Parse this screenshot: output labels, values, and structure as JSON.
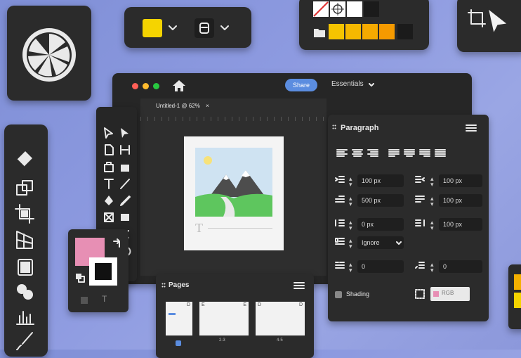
{
  "colors": {
    "bg": "#8c98db",
    "panel": "#2b2b2b",
    "accent_blue": "#5b8de0",
    "pink": "#e78fb4",
    "yellow": "#f5d400"
  },
  "app": {
    "share_label": "Share",
    "workspace_label": "Essentials",
    "doc_tab": "Untitled-1 @ 62%",
    "doc_tab_close": "×"
  },
  "paragraph": {
    "title": "Paragraph",
    "fields": {
      "indent_left": "100 px",
      "indent_right": "100 px",
      "first_line": "500 px",
      "space_after_list": "100 px",
      "space_before": "0 px",
      "space_after": "100 px",
      "hyphenation": "Ignore",
      "baseline_left": "0",
      "baseline_right": "0"
    },
    "shading_label": "Shading",
    "shading_color_label": "RGB"
  },
  "pages": {
    "title": "Pages",
    "items": [
      {
        "caption": "",
        "left": "",
        "right": "D"
      },
      {
        "caption": "2-3",
        "left": "E",
        "right": "E"
      },
      {
        "caption": "4-5",
        "left": "D",
        "right": "D"
      }
    ]
  },
  "swatches": {
    "row1": [
      "none",
      "none",
      "#ffffff",
      "#1b1b1b"
    ],
    "row2": [
      "#f5c400",
      "#f5b800",
      "#f5aa00",
      "#f59a00",
      "#1b1b1b"
    ]
  },
  "canvas_glyph": "T",
  "fill_stroke_glyph": "T",
  "icons": {
    "chevron": "chevron-down-icon"
  }
}
